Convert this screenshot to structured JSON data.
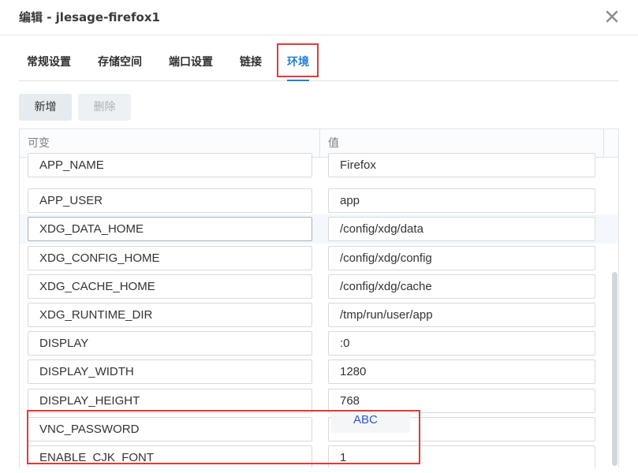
{
  "dialog": {
    "title": "编辑 - jlesage-firefox1"
  },
  "tabs": [
    {
      "label": "常规设置",
      "active": false
    },
    {
      "label": "存储空间",
      "active": false
    },
    {
      "label": "端口设置",
      "active": false
    },
    {
      "label": "链接",
      "active": false
    },
    {
      "label": "环境",
      "active": true
    }
  ],
  "toolbar": {
    "add_label": "新增",
    "delete_label": "删除"
  },
  "grid": {
    "columns": [
      "可变",
      "值"
    ],
    "rows": [
      {
        "key": "APP_NAME",
        "value": "Firefox"
      },
      {
        "key": "APP_USER",
        "value": "app"
      },
      {
        "key": "XDG_DATA_HOME",
        "value": "/config/xdg/data"
      },
      {
        "key": "XDG_CONFIG_HOME",
        "value": "/config/xdg/config"
      },
      {
        "key": "XDG_CACHE_HOME",
        "value": "/config/xdg/cache"
      },
      {
        "key": "XDG_RUNTIME_DIR",
        "value": "/tmp/run/user/app"
      },
      {
        "key": "DISPLAY",
        "value": ":0"
      },
      {
        "key": "DISPLAY_WIDTH",
        "value": "1280"
      },
      {
        "key": "DISPLAY_HEIGHT",
        "value": "768"
      },
      {
        "key": "VNC_PASSWORD",
        "value": ""
      },
      {
        "key": "ENABLE_CJK_FONT",
        "value": "1"
      }
    ]
  },
  "annotation": {
    "overlay_text": "ABC",
    "highlight_color": "#e53935"
  },
  "colors": {
    "accent": "#1f7fd6"
  }
}
